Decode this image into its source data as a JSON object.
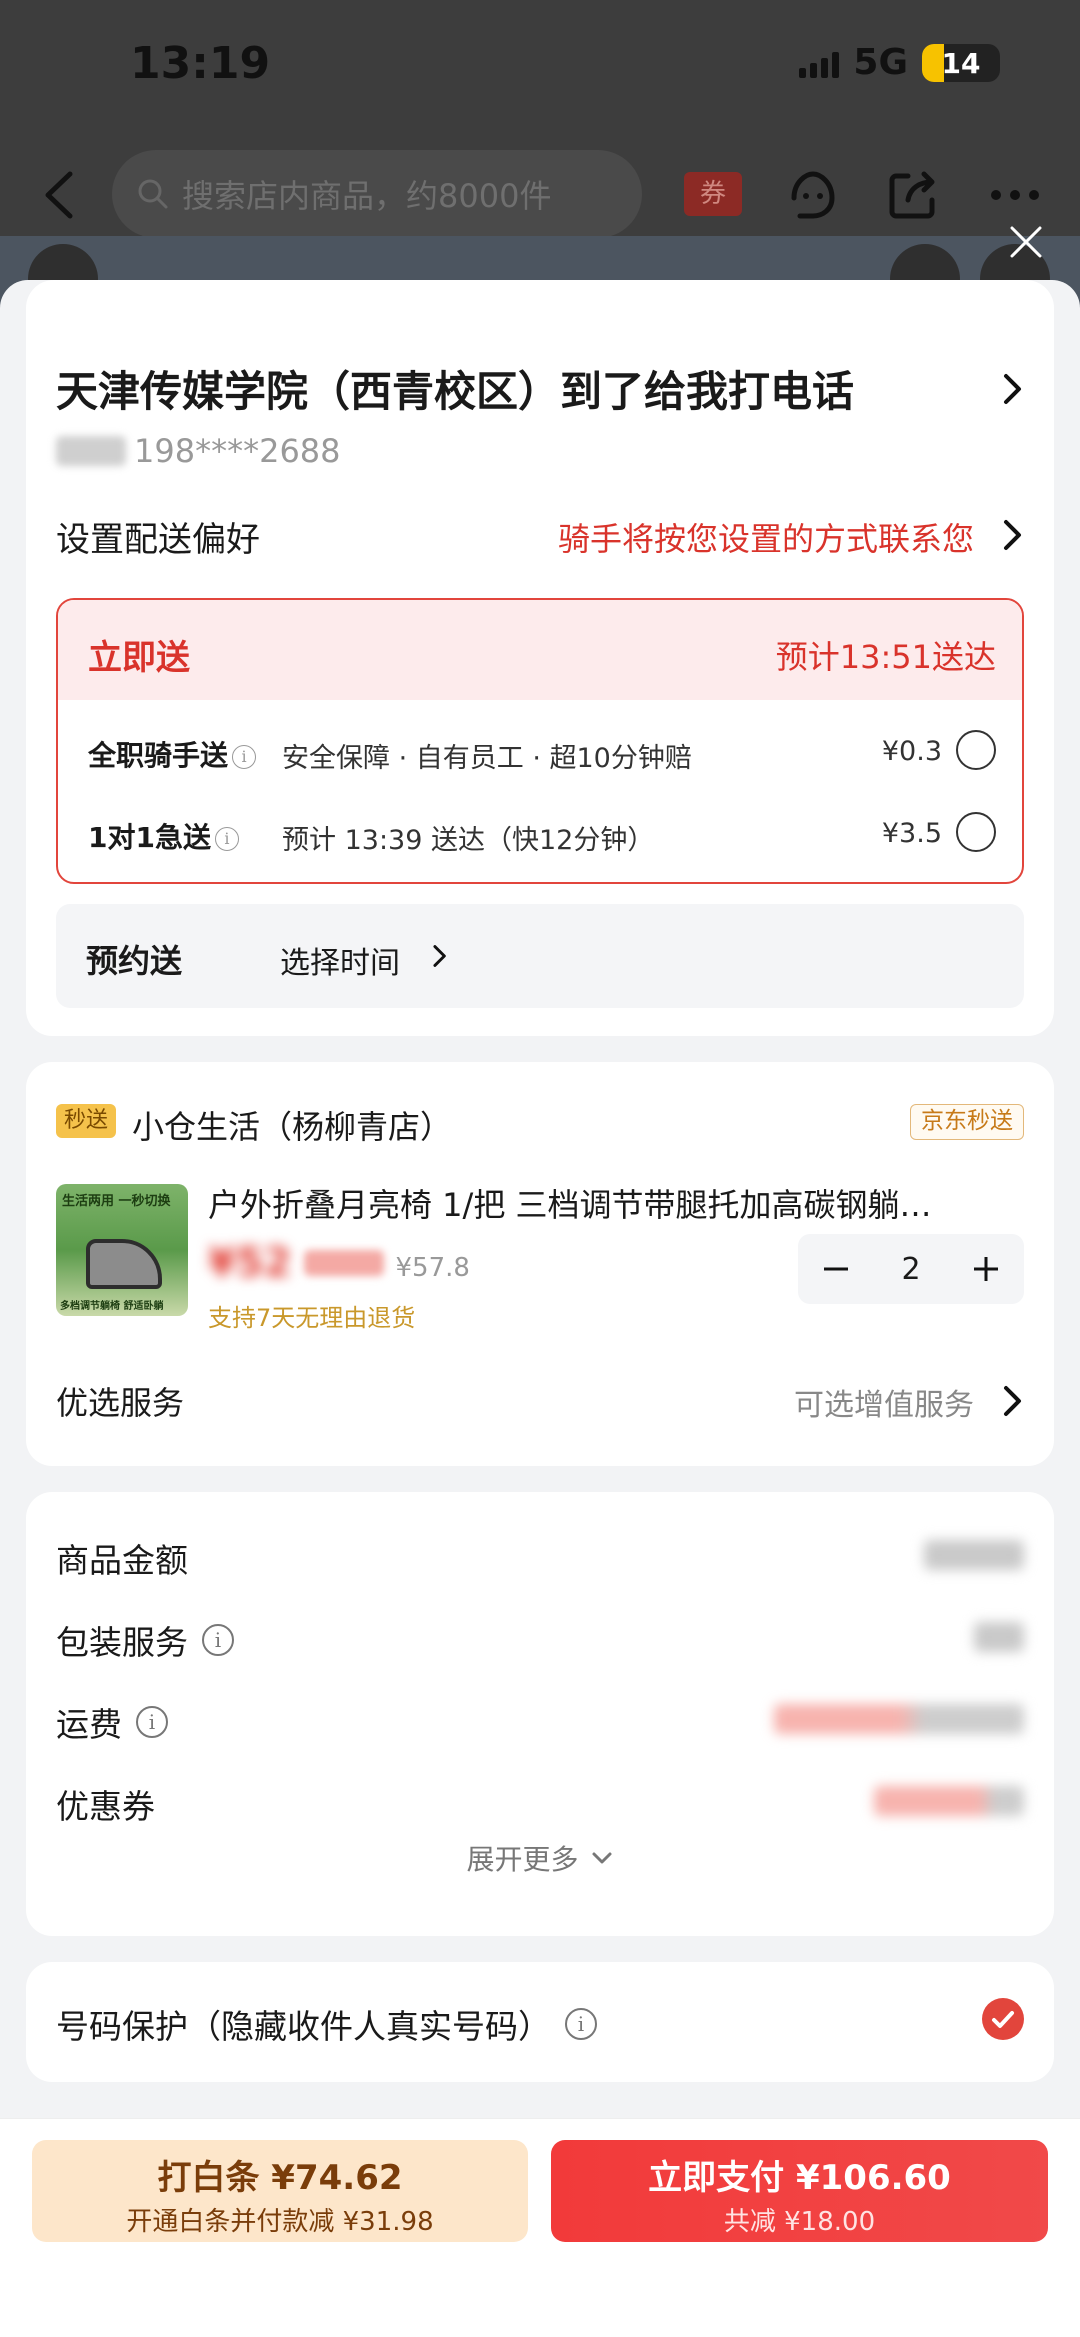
{
  "status_bar": {
    "time": "13:19",
    "network": "5G",
    "battery": "14"
  },
  "nav": {
    "search_placeholder": "搜索店内商品，约8000件",
    "coupon_label": "券"
  },
  "address": {
    "title": "天津传媒学院（西青校区）到了给我打电话",
    "phone": "198****2688"
  },
  "delivery_pref": {
    "label": "设置配送偏好",
    "value": "骑手将按您设置的方式联系您"
  },
  "instant": {
    "label": "立即送",
    "eta": "预计13:51送达",
    "options": [
      {
        "name": "全职骑手送",
        "desc": "安全保障 · 自有员工 · 超10分钟赔",
        "price": "¥0.3"
      },
      {
        "name": "1对1急送",
        "desc": "预计 13:39 送达（快12分钟）",
        "price": "¥3.5"
      }
    ]
  },
  "schedule": {
    "label": "预约送",
    "value": "选择时间"
  },
  "store": {
    "badge": "秒送",
    "name": "小仓生活（杨柳青店）",
    "tag": "京东秒送",
    "product": {
      "title": "户外折叠月亮椅 1/把 三档调节带腿托加高碳钢躺…",
      "image_text_top": "生活两用 一秒切换",
      "image_text_bottom": "多档调节躺椅 舒适卧躺",
      "price": "¥52",
      "original_price": "¥57.8",
      "return_policy": "支持7天无理由退货",
      "quantity": "2"
    },
    "service": {
      "label": "优选服务",
      "value": "可选增值服务"
    }
  },
  "fees": {
    "rows": [
      {
        "label": "商品金额",
        "info": false
      },
      {
        "label": "包装服务",
        "info": true
      },
      {
        "label": "运费",
        "info": true
      },
      {
        "label": "优惠券",
        "info": false
      }
    ],
    "expand": "展开更多"
  },
  "privacy": {
    "label": "号码保护（隐藏收件人真实号码）",
    "checked": true
  },
  "bottom": {
    "baitiao_title": "打白条 ¥74.62",
    "baitiao_sub": "开通白条并付款减 ¥31.98",
    "pay_title": "立即支付 ¥106.60",
    "pay_sub": "共减 ¥18.00"
  },
  "colors": {
    "accent": "#e2453c",
    "gold": "#c9982b",
    "baitiao_bg": "#fde6ca"
  }
}
